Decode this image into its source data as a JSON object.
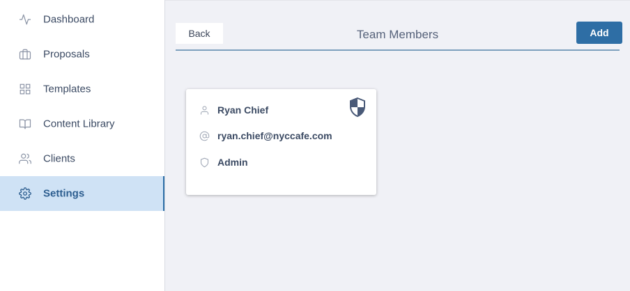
{
  "sidebar": {
    "items": [
      {
        "label": "Dashboard",
        "icon": "activity-icon",
        "active": false
      },
      {
        "label": "Proposals",
        "icon": "briefcase-icon",
        "active": false
      },
      {
        "label": "Templates",
        "icon": "grid-icon",
        "active": false
      },
      {
        "label": "Content Library",
        "icon": "book-icon",
        "active": false
      },
      {
        "label": "Clients",
        "icon": "users-icon",
        "active": false
      },
      {
        "label": "Settings",
        "icon": "gear-icon",
        "active": true
      }
    ]
  },
  "header": {
    "back_label": "Back",
    "title": "Team Members",
    "add_label": "Add"
  },
  "member": {
    "name": "Ryan Chief",
    "email": "ryan.chief@nyccafe.com",
    "role": "Admin",
    "badge_icon": "shield-admin-icon"
  },
  "colors": {
    "accent": "#2e6ea5",
    "active_bg": "#cfe2f5",
    "page_bg": "#f0f1f6"
  }
}
